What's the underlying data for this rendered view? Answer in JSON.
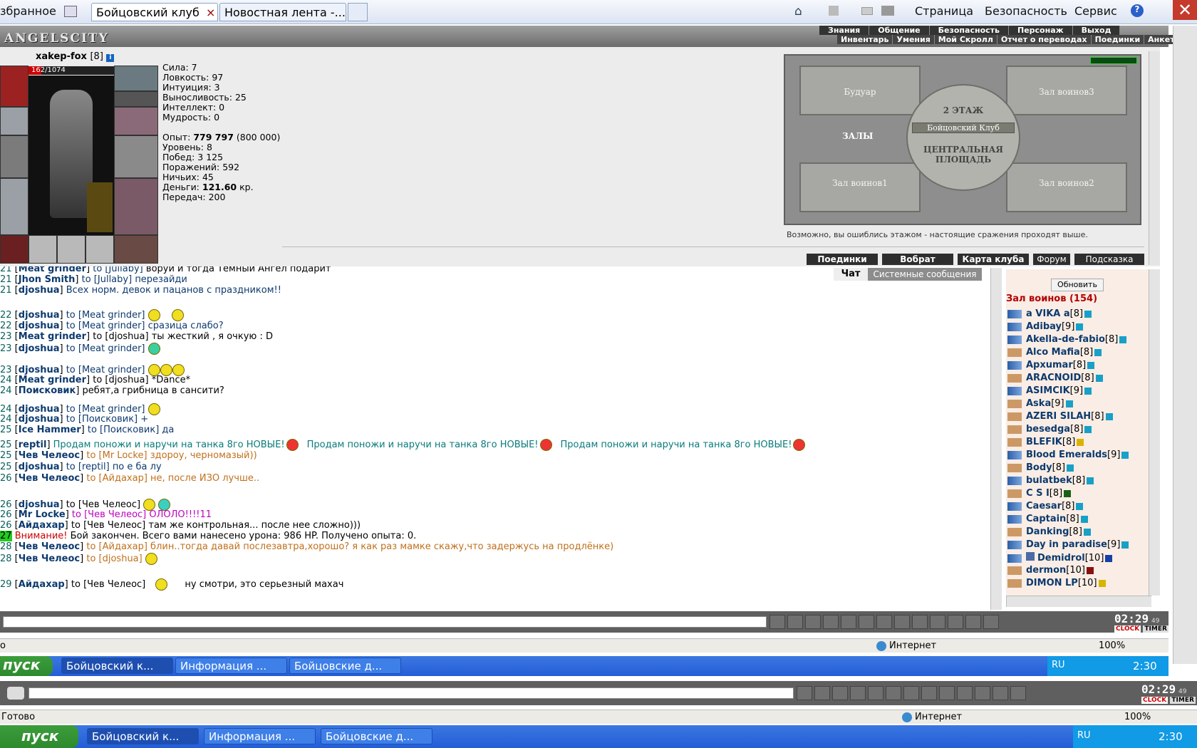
{
  "browser": {
    "favorites": "збранное",
    "tabs": [
      {
        "label": "Бойцовский клуб"
      },
      {
        "label": "Новостная лента -..."
      }
    ],
    "menu": [
      "Страница",
      "Безопасность",
      "Сервис"
    ]
  },
  "game": {
    "logo": "ANGELSCITY",
    "menu_top": [
      "Знания",
      "Общение",
      "Безопасность",
      "Персонаж",
      "Выход"
    ],
    "menu_bottom": [
      "Инвентарь",
      "Умения",
      "Мой Скролл",
      "Отчет о переводах",
      "Поединки",
      "Анкета"
    ],
    "nick": "xakep-fox",
    "nick_level": "[8]",
    "hp": "162/1074",
    "hp_fraction": 0.151,
    "stats": {
      "sila": "Сила: 7",
      "lovkost": "Ловкость: 97",
      "intuicia": "Интуиция: 3",
      "vynoslivost": "Выносливость: 25",
      "intellekt": "Интеллект: 0",
      "mudrost": "Мудрость: 0",
      "opyt_label": "Опыт:",
      "opyt_value": "779 797",
      "opyt_next": "(800 000)",
      "uroven": "Уровень: 8",
      "pobed": "Побед: 3 125",
      "porazheniy": "Поражений: 592",
      "nichyih": "Ничьих: 45",
      "dengi_label": "Деньги:",
      "dengi_value": "121.60",
      "dengi_unit": "кр.",
      "peredach": "Передач: 200"
    },
    "map": {
      "rooms": [
        "Будуар",
        "Зал воинов3",
        "ЗАЛЫ",
        "Бойцовский Клуб",
        "Зал воинов1",
        "Зал воинов2"
      ],
      "floor": "2 ЭТАЖ",
      "center_line1": "ЦЕНТРАЛЬНАЯ",
      "center_line2": "ПЛОЩАДЬ",
      "note": "Возможно, вы ошиблись этажом - настоящие сражения проходят выше."
    },
    "buttons": [
      "Поединки",
      "Вобрат",
      "Карта клуба",
      "Форум",
      "Подсказка"
    ]
  },
  "chat": {
    "tab_chat": "Чат",
    "tab_system": "Системные сообщения",
    "lines": [
      {
        "t": "21",
        "from": "Meat grinder",
        "to": "to [Jullaby]",
        "msg": "вoруй и тогда Темный Ангел подарит"
      },
      {
        "t": "21",
        "from": "Jhon Smith",
        "to": "to [Jullaby]",
        "msg": "перезайди"
      },
      {
        "t": "21",
        "from": "djoshua",
        "to": "",
        "msg": "Всех норм. девок и пацанoв с праздником!!"
      },
      {
        "t": "22",
        "from": "djoshua",
        "to": "to [Meat grinder]",
        "msg": ""
      },
      {
        "t": "22",
        "from": "djoshua",
        "to": "to [Meat grinder]",
        "msg": "сразица слабо?"
      },
      {
        "t": "23",
        "from": "Meat grinder",
        "to": "to [djoshua]",
        "msg": "ты жесткий , я очкую : D"
      },
      {
        "t": "23",
        "from": "djoshua",
        "to": "to [Meat grinder]",
        "msg": ""
      },
      {
        "t": "23",
        "from": "djoshua",
        "to": "to [Meat grinder]",
        "msg": ""
      },
      {
        "t": "24",
        "from": "Meat grinder",
        "to": "to [djoshua]",
        "msg": "*Dance*"
      },
      {
        "t": "24",
        "from": "Поисковик",
        "to": "",
        "msg": "ребят,а грибница в сансити?"
      },
      {
        "t": "24",
        "from": "djoshua",
        "to": "to [Meat grinder]",
        "msg": ""
      },
      {
        "t": "24",
        "from": "djoshua",
        "to": "to [Поисковик]",
        "msg": "+"
      },
      {
        "t": "25",
        "from": "Ice Hammer",
        "to": "to [Поисковик]",
        "msg": "да"
      },
      {
        "t": "25",
        "from": "reptil",
        "to": "",
        "msg": "Продам поножи и наручи на танка 8го НОВЫЕ!"
      },
      {
        "t": "25",
        "from": "Чев Челеос",
        "to": "to [Mr Locke]",
        "msg": "здорoу, черномазый))"
      },
      {
        "t": "25",
        "from": "djoshua",
        "to": "to [reptil]",
        "msg": "по е ба лу"
      },
      {
        "t": "26",
        "from": "Чев Челеос",
        "to": "to [Айдахар]",
        "msg": "не, после ИЗО лучше.."
      },
      {
        "t": "26",
        "from": "djoshua",
        "to": "to [Чев Челеос]",
        "msg": ""
      },
      {
        "t": "26",
        "from": "Mr Locke",
        "to": "to [Чев Челеос]",
        "msg": "ОЛОЛО!!!!11"
      },
      {
        "t": "26",
        "from": "Айдахар",
        "to": "to [Чев Челеос]",
        "msg": "там же контрольная... после нее сложно)))"
      },
      {
        "t": "27",
        "from": "",
        "to": "",
        "msg": "Бой закончен. Всего вами нанесено урона: 986 HP. Получено опыта: 0.",
        "warn": "Внимание!"
      },
      {
        "t": "28",
        "from": "Чев Челеос",
        "to": "to [Айдахар]",
        "msg": "блин..тогда давай послезавтра,хорошо? я как раз мамке скажу,что задержусь на продлёнке)"
      },
      {
        "t": "28",
        "from": "Чев Челеос",
        "to": "to [djoshua]",
        "msg": ""
      },
      {
        "t": "29",
        "from": "Айдахар",
        "to": "to [Чев Челеос]",
        "msg": "ну смотри, это серьезный махач"
      }
    ]
  },
  "room": {
    "refresh": "Обновить",
    "title": "Зал воинов (154)",
    "players": [
      {
        "name": "a VIKA a",
        "lv": "[8]"
      },
      {
        "name": "Adibay",
        "lv": "[9]"
      },
      {
        "name": "Akella-de-fabio",
        "lv": "[8]"
      },
      {
        "name": "Alco Mafia",
        "lv": "[8]"
      },
      {
        "name": "Архumar",
        "lv": "[8]"
      },
      {
        "name": "ARACNOID",
        "lv": "[8]"
      },
      {
        "name": "ASIMCIK",
        "lv": "[9]"
      },
      {
        "name": "Aska",
        "lv": "[9]"
      },
      {
        "name": "AZERI SILAH",
        "lv": "[8]"
      },
      {
        "name": "besedga",
        "lv": "[8]"
      },
      {
        "name": "BLEFIK",
        "lv": "[8]"
      },
      {
        "name": "Blood Emeralds",
        "lv": "[9]"
      },
      {
        "name": "Body",
        "lv": "[8]"
      },
      {
        "name": "bulatbek",
        "lv": "[8]"
      },
      {
        "name": "C S I",
        "lv": "[8]"
      },
      {
        "name": "Caesar",
        "lv": "[8]"
      },
      {
        "name": "Captain",
        "lv": "[8]"
      },
      {
        "name": "Danking",
        "lv": "[8]"
      },
      {
        "name": "Day in paradise",
        "lv": "[9]"
      },
      {
        "name": "Demidrol",
        "lv": "[10]"
      },
      {
        "name": "dermon",
        "lv": "[10]"
      },
      {
        "name": "DIMON LP",
        "lv": "[10]"
      }
    ]
  },
  "clock": {
    "time": "02:29",
    "sec": "49",
    "labels": [
      "CLOCK",
      "TIMER"
    ]
  },
  "status": {
    "zone": "Интернет",
    "zoom": "100%",
    "ready": "Готово"
  },
  "taskbar": {
    "start": "пуск",
    "tasks": [
      "Бойцовский к...",
      "Информация ...",
      "Бойцовские д..."
    ],
    "lang": "RU",
    "time": "2:30"
  }
}
